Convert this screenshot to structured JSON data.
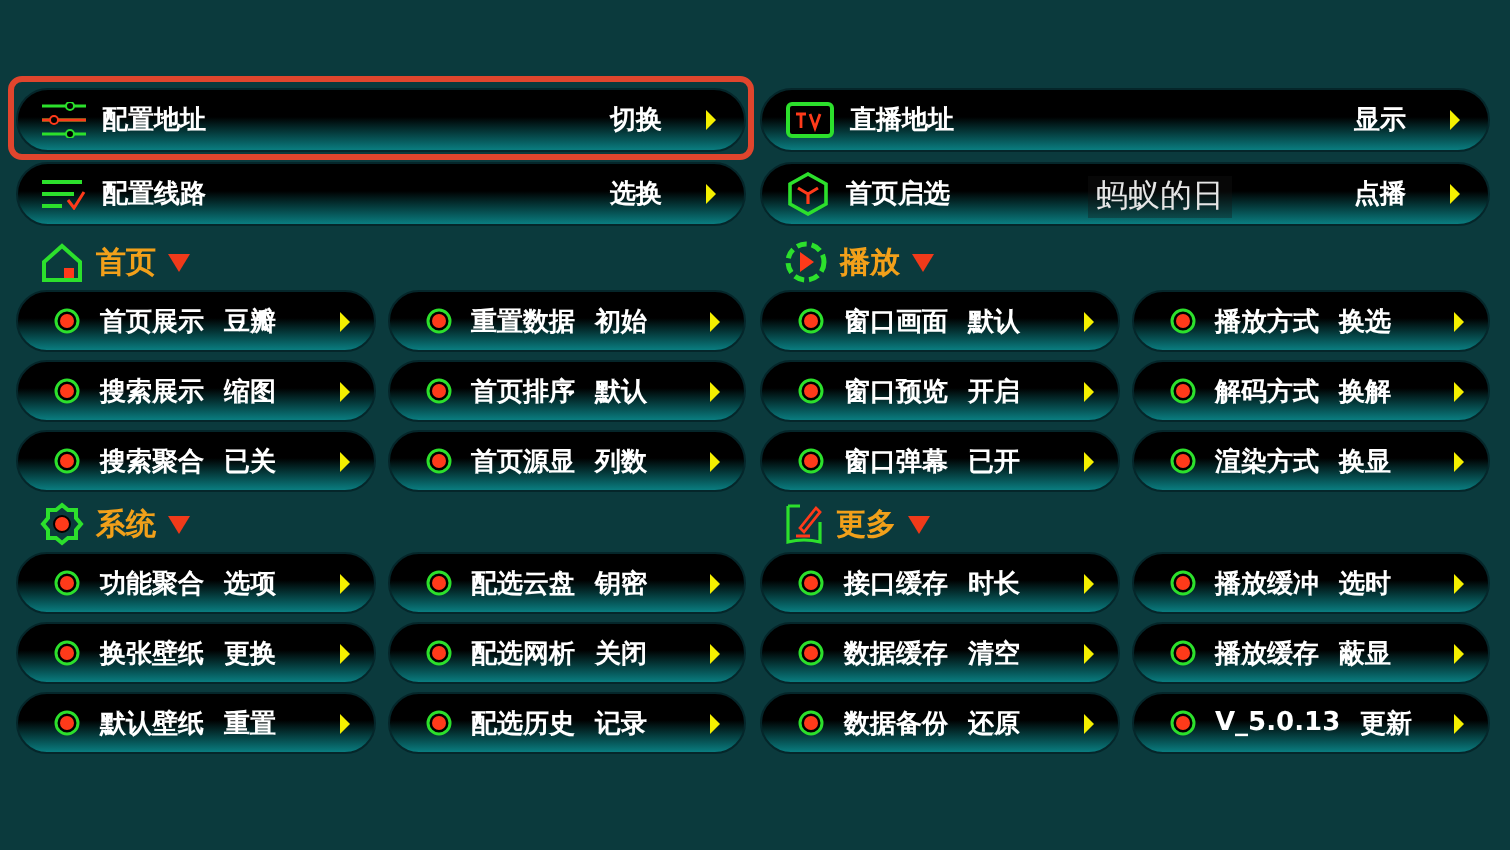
{
  "top_items": [
    {
      "label": "配置地址",
      "value": "切换",
      "selected": true
    },
    {
      "label": "直播地址",
      "value": "显示",
      "selected": false
    },
    {
      "label": "配置线路",
      "value": "选换",
      "selected": false
    },
    {
      "label": "首页启选",
      "value": "点播",
      "selected": false
    }
  ],
  "toast": {
    "text": "蚂蚁的日"
  },
  "section_rows": [
    [
      {
        "title": "首页",
        "items": [
          {
            "label": "首页展示",
            "value": "豆瓣"
          },
          {
            "label": "重置数据",
            "value": "初始"
          },
          {
            "label": "搜索展示",
            "value": "缩图"
          },
          {
            "label": "首页排序",
            "value": "默认"
          },
          {
            "label": "搜索聚合",
            "value": "已关"
          },
          {
            "label": "首页源显",
            "value": "列数"
          }
        ]
      },
      {
        "title": "播放",
        "items": [
          {
            "label": "窗口画面",
            "value": "默认"
          },
          {
            "label": "播放方式",
            "value": "换选"
          },
          {
            "label": "窗口预览",
            "value": "开启"
          },
          {
            "label": "解码方式",
            "value": "换解"
          },
          {
            "label": "窗口弹幕",
            "value": "已开"
          },
          {
            "label": "渲染方式",
            "value": "换显"
          }
        ]
      }
    ],
    [
      {
        "title": "系统",
        "items": [
          {
            "label": "功能聚合",
            "value": "选项"
          },
          {
            "label": "配选云盘",
            "value": "钥密"
          },
          {
            "label": "换张壁纸",
            "value": "更换"
          },
          {
            "label": "配选网析",
            "value": "关闭"
          },
          {
            "label": "默认壁纸",
            "value": "重置"
          },
          {
            "label": "配选历史",
            "value": "记录"
          }
        ]
      },
      {
        "title": "更多",
        "items": [
          {
            "label": "接口缓存",
            "value": "时长"
          },
          {
            "label": "播放缓冲",
            "value": "选时"
          },
          {
            "label": "数据缓存",
            "value": "清空"
          },
          {
            "label": "播放缓存",
            "value": "蔽显"
          },
          {
            "label": "数据备份",
            "value": "还原"
          },
          {
            "label": "V_5.0.13",
            "value": "更新"
          }
        ]
      }
    ]
  ]
}
